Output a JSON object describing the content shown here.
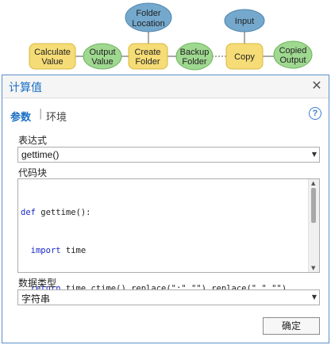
{
  "diagram": {
    "nodes": [
      {
        "id": "calculate-value",
        "lines": [
          "Calculate",
          "Value"
        ],
        "shape": "rounded-rect",
        "color": "#f5dc76"
      },
      {
        "id": "output-value",
        "lines": [
          "Output",
          "Value"
        ],
        "shape": "ellipse",
        "color": "#9fd890"
      },
      {
        "id": "folder-location",
        "lines": [
          "Folder",
          "Location"
        ],
        "shape": "ellipse",
        "color": "#74a8cc"
      },
      {
        "id": "create-folder",
        "lines": [
          "Create",
          "Folder"
        ],
        "shape": "rounded-rect",
        "color": "#f5dc76"
      },
      {
        "id": "backup-folder",
        "lines": [
          "Backup",
          "Folder"
        ],
        "shape": "ellipse",
        "color": "#9fd890"
      },
      {
        "id": "input",
        "lines": [
          "Input"
        ],
        "shape": "ellipse",
        "color": "#74a8cc"
      },
      {
        "id": "copy",
        "lines": [
          "Copy"
        ],
        "shape": "rounded-rect",
        "color": "#f5dc76"
      },
      {
        "id": "copied-output",
        "lines": [
          "Copied",
          "Output"
        ],
        "shape": "ellipse",
        "color": "#9fd890"
      }
    ]
  },
  "dialog": {
    "title": "计算值",
    "close_label": "✕",
    "tabs": {
      "params": "参数",
      "separator": "|",
      "env": "环境"
    },
    "help_label": "?",
    "expression": {
      "label": "表达式",
      "value": "gettime()",
      "arrow": "▼"
    },
    "code_block": {
      "label": "代码块",
      "lines": [
        {
          "kw": "def",
          "rest": " gettime():",
          "indent": ""
        },
        {
          "kw": "import",
          "rest": " time",
          "indent": "  "
        },
        {
          "kw": "return",
          "rest": " time.ctime().replace(\":\",\"\").replace(\" \",\"\")",
          "indent": "  "
        }
      ],
      "scroll_up": "▲",
      "scroll_down": "▼"
    },
    "data_type": {
      "label": "数据类型",
      "value": "字符串",
      "arrow": "▼"
    },
    "ok_label": "确定"
  },
  "colors": {
    "accent": "#1a6fc4",
    "process": "#f5dc76",
    "output": "#9fd890",
    "input": "#74a8cc"
  }
}
